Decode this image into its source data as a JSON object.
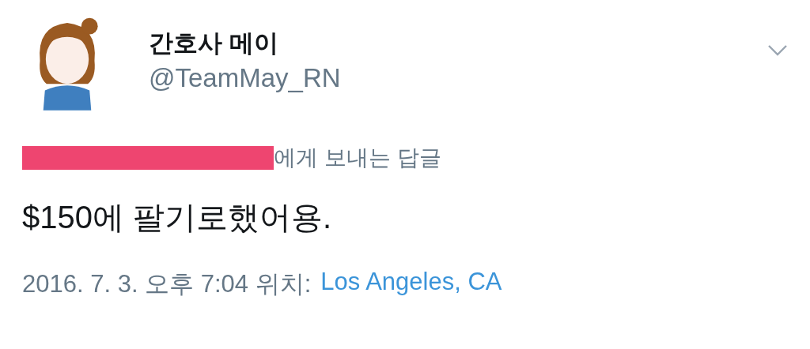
{
  "author": {
    "name": "간호사 메이",
    "handle": "@TeamMay_RN"
  },
  "reply_to": {
    "text": "에게 보내는 답글"
  },
  "tweet": {
    "text": "$150에 팔기로했어용."
  },
  "meta": {
    "timestamp": "2016. 7. 3. 오후 7:04 위치:",
    "location": "Los Angeles, CA"
  }
}
